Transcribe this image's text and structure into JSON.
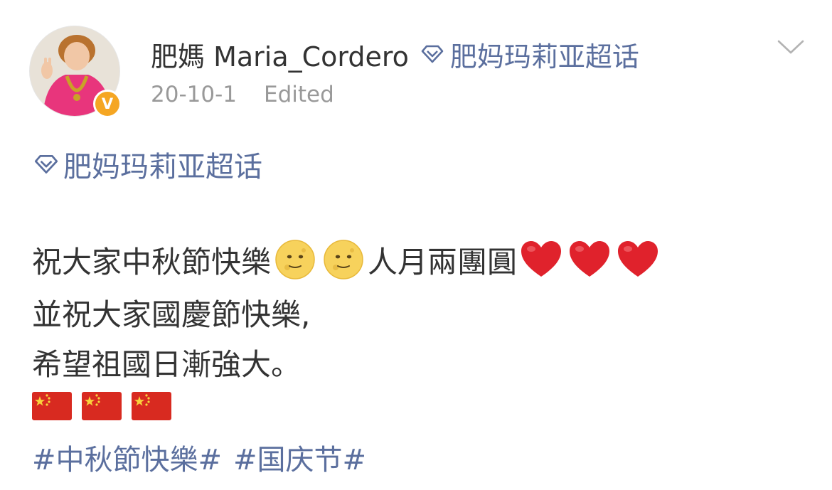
{
  "post": {
    "author": {
      "name": "肥媽 Maria_Cordero",
      "verified_badge": "V",
      "badge_color": "#f5a623"
    },
    "supertopic": {
      "label": "肥妈玛莉亚超话",
      "icon": "diamond-icon",
      "color": "#5b6f9e"
    },
    "meta": {
      "date": "20-10-1",
      "edited": "Edited"
    },
    "menu_icon": "chevron-down-icon",
    "topic_link": "肥妈玛莉亚超话",
    "content": {
      "line1_part1": "祝大家中秋節快樂",
      "line1_part2": "人月兩團圓",
      "line1_emojis_moon": [
        "full-moon-face-icon",
        "full-moon-face-icon"
      ],
      "line1_emojis_heart": [
        "red-heart-icon",
        "red-heart-icon",
        "red-heart-icon"
      ],
      "line2": "並祝大家國慶節快樂,",
      "line3": "希望祖國日漸強大。",
      "flags": [
        "china-flag-icon",
        "china-flag-icon",
        "china-flag-icon"
      ]
    },
    "hashtags": [
      "#中秋節快樂#",
      "#国庆节#"
    ],
    "text_color": "#333333",
    "meta_color": "#999999"
  }
}
